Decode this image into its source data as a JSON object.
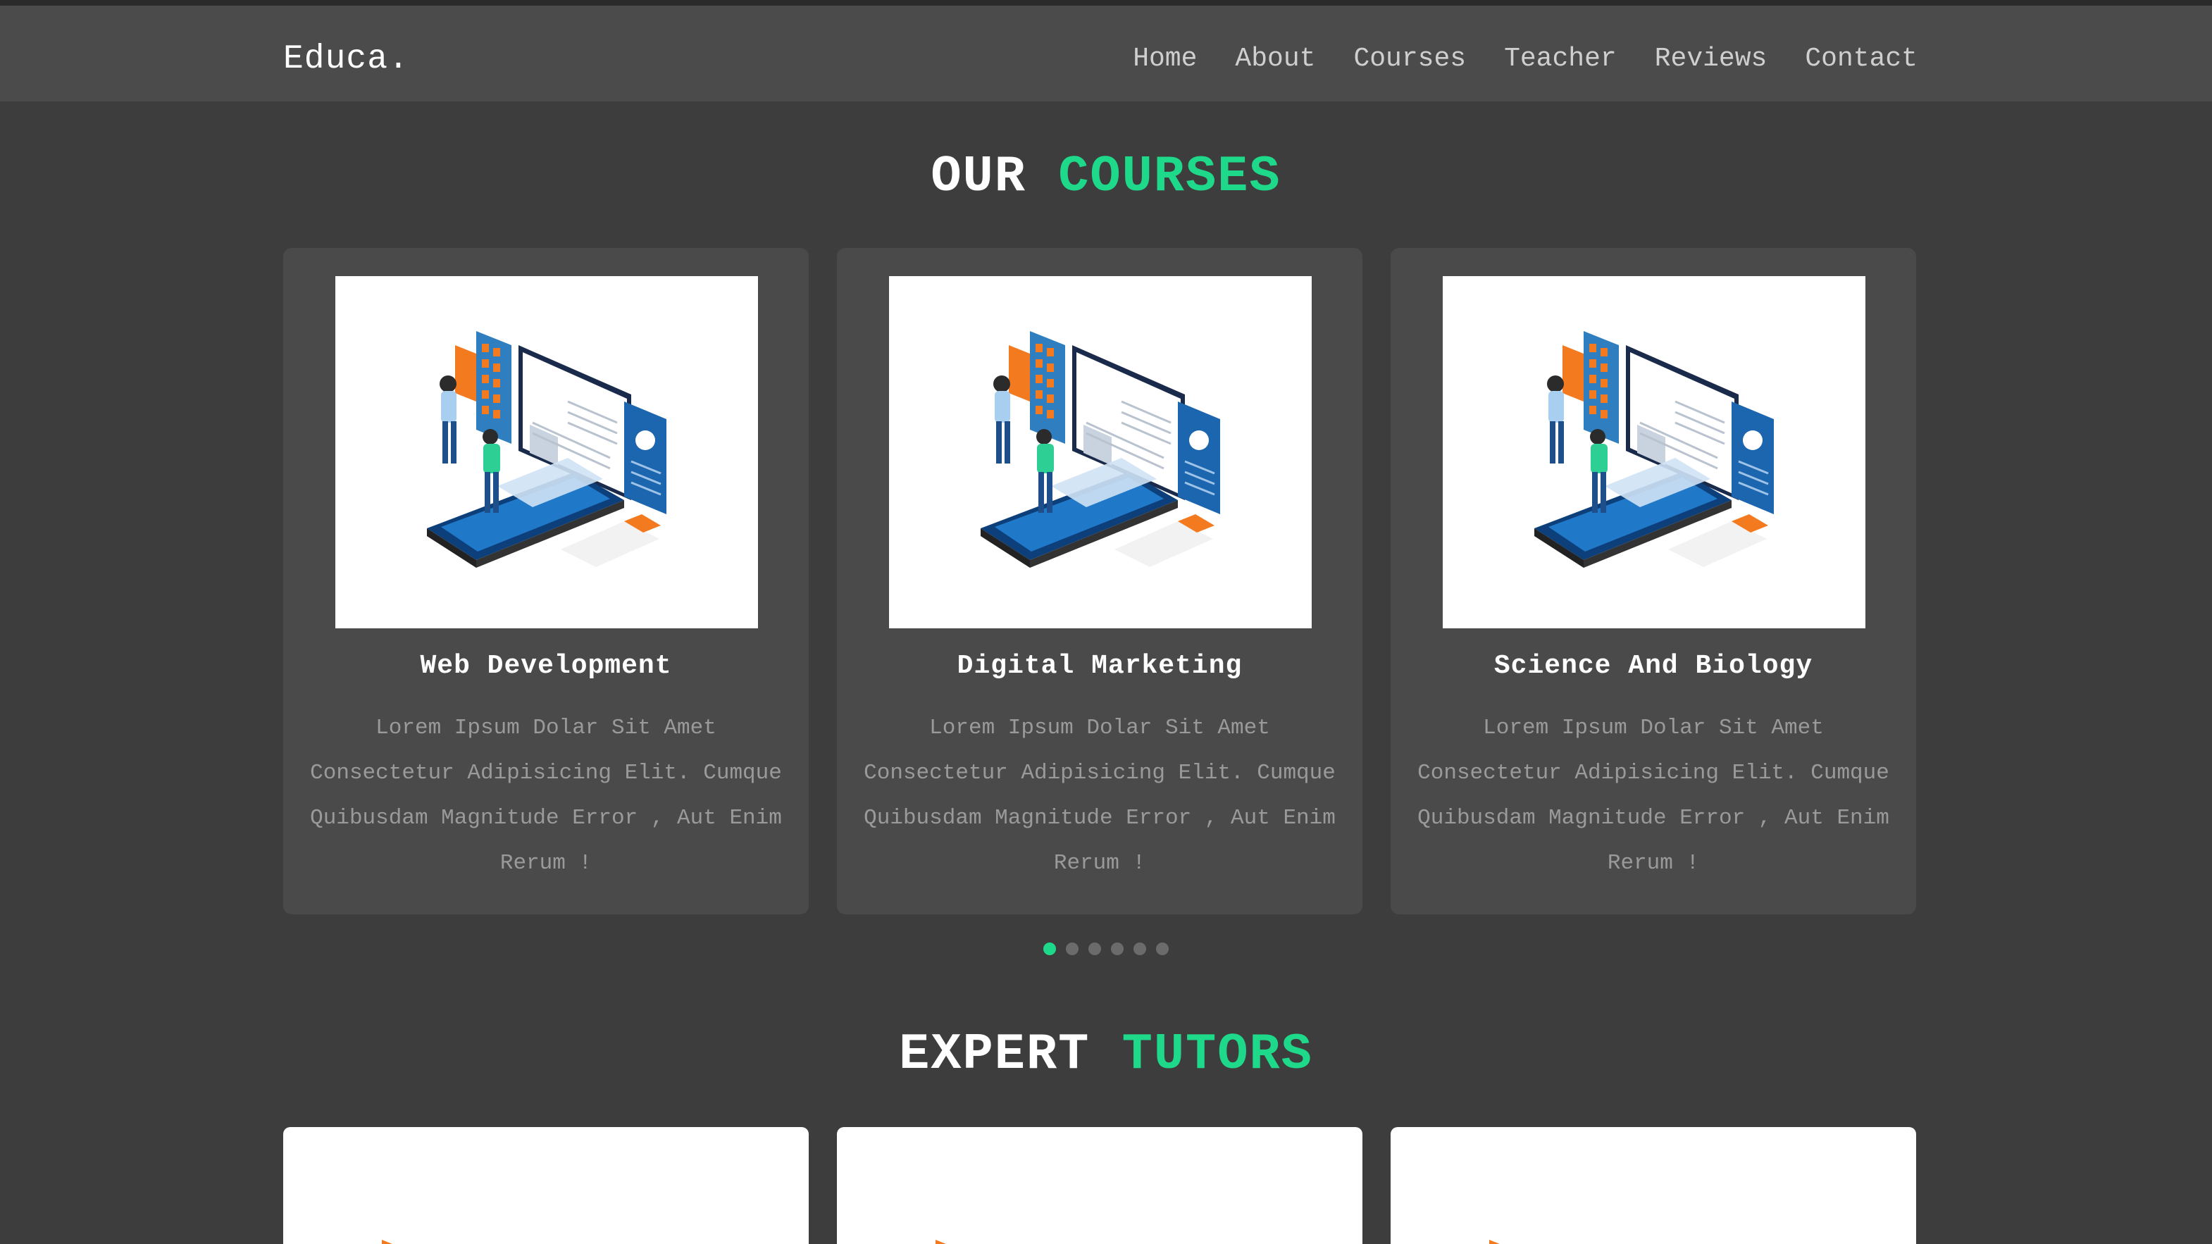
{
  "brand": {
    "logo": "Educa."
  },
  "nav": {
    "items": [
      "Home",
      "About",
      "Courses",
      "Teacher",
      "Reviews",
      "Contact"
    ]
  },
  "courses_section": {
    "title_white": "OUR",
    "title_green": "COURSES",
    "cards": [
      {
        "title": "Web Development",
        "description": "Lorem Ipsum Dolar Sit Amet Consectetur Adipisicing Elit. Cumque Quibusdam Magnitude Error , Aut Enim Rerum !"
      },
      {
        "title": "Digital Marketing",
        "description": "Lorem Ipsum Dolar Sit Amet Consectetur Adipisicing Elit. Cumque Quibusdam Magnitude Error , Aut Enim Rerum !"
      },
      {
        "title": "Science And Biology",
        "description": "Lorem Ipsum Dolar Sit Amet Consectetur Adipisicing Elit. Cumque Quibusdam Magnitude Error , Aut Enim Rerum !"
      }
    ],
    "pagination": {
      "total": 6,
      "active_index": 0
    }
  },
  "tutors_section": {
    "title_white": "EXPERT",
    "title_green": "TUTORS",
    "cards_visible": 3
  },
  "colors": {
    "background": "#3d3d3d",
    "header": "#4b4b4b",
    "card": "#4a4a4a",
    "accent": "#1fd98a",
    "muted_text": "#9a9a9a"
  },
  "icons": {
    "course_image": "isometric-online-learning-illustration"
  }
}
